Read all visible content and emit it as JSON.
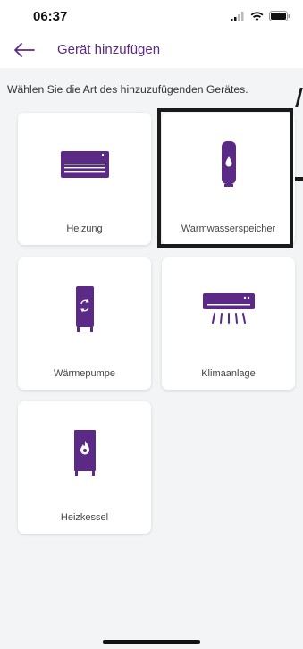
{
  "status_bar": {
    "time": "06:37",
    "icons": [
      "cellular-signal-icon",
      "wifi-icon",
      "battery-icon"
    ]
  },
  "app_bar": {
    "back_icon": "arrow-left-icon",
    "title": "Gerät hinzufügen"
  },
  "instruction": "Wählen Sie die Art des hinzuzufügenden Gerätes.",
  "devices": [
    {
      "label": "Heizung",
      "icon": "heater-icon"
    },
    {
      "label": "Warmwasserspeicher",
      "icon": "water-tank-icon",
      "highlighted": true
    },
    {
      "label": "Wärmepumpe",
      "icon": "heat-pump-icon"
    },
    {
      "label": "Klimaanlage",
      "icon": "air-conditioner-icon"
    },
    {
      "label": "Heizkessel",
      "icon": "boiler-icon"
    }
  ],
  "colors": {
    "accent": "#5b2a86",
    "background": "#f2f4f6",
    "tile": "#ffffff",
    "highlight_frame": "#1a1a1a"
  }
}
